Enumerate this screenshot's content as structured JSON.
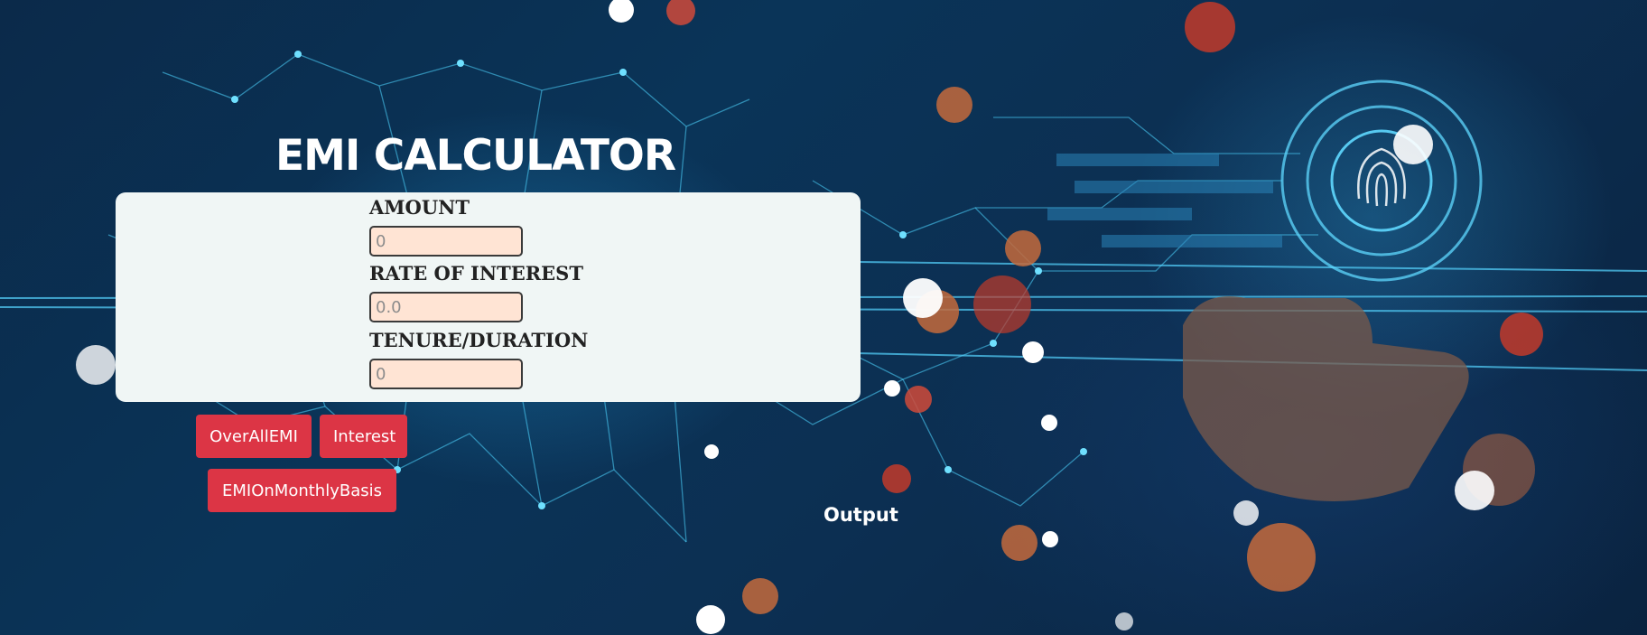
{
  "page": {
    "title": "EMI CALCULATOR",
    "output_label": "Output"
  },
  "form": {
    "amount": {
      "label": "AMOUNT",
      "placeholder": "0"
    },
    "rate": {
      "label": "RATE OF INTEREST",
      "placeholder": "0.0"
    },
    "tenure": {
      "label": "TENURE/DURATION",
      "placeholder": "0"
    }
  },
  "buttons": {
    "overall": "OverAllEMI",
    "interest": "Interest",
    "monthly": "EMIOnMonthlyBasis"
  },
  "colors": {
    "button_bg": "#dc3545",
    "input_bg": "#ffe4d4",
    "panel_bg": "#f0f6f5",
    "text_light": "#ffffff"
  }
}
